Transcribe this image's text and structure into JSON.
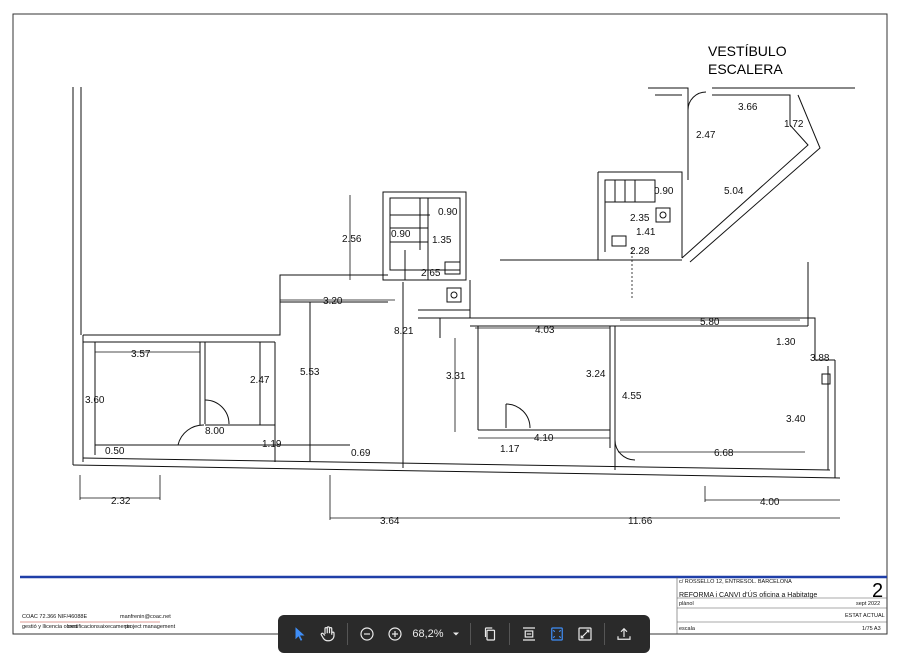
{
  "plan": {
    "title_vestibulo": "VESTÍBULO",
    "title_escalera": "ESCALERA",
    "dimensions": [
      "3.66",
      "1.72",
      "2.47",
      "5.04",
      "0.90",
      "2.35",
      "1.41",
      "2.28",
      "0.90",
      "0.90",
      "1.35",
      "2.56",
      "2.65",
      "3.20",
      "8.21",
      "4.03",
      "5.80",
      "1.30",
      "3.88",
      "3.57",
      "2.47",
      "5.53",
      "3.31",
      "3.24",
      "4.55",
      "3.40",
      "3.60",
      "8.00",
      "1.19",
      "4.10",
      "0.50",
      "0.69",
      "1.17",
      "6.68",
      "2.32",
      "4.00",
      "3.64",
      "11.66"
    ]
  },
  "title_block": {
    "address": "c/ ROSSELLO 12, ENTRESOL. BARCELONA",
    "project": "REFORMA i CANVI d'ÚS oficina  a Habitatge",
    "sheet_number": "2",
    "plan_label": "plànol",
    "date": "sept 2022",
    "state": "ESTAT ACTUAL",
    "scale_label": "escala",
    "scale_value": "1/75 A3",
    "left_code": "COAC 72.366   NIF/46088E",
    "left_email": "manfrenin@coac.net",
    "left_services": [
      "gestió y llicencia obres",
      "certificacions",
      "aixecaments",
      "project management"
    ]
  },
  "toolbar": {
    "zoom": "68,2%",
    "accent": "#3f8ef7",
    "background": "#2a2a2a"
  }
}
